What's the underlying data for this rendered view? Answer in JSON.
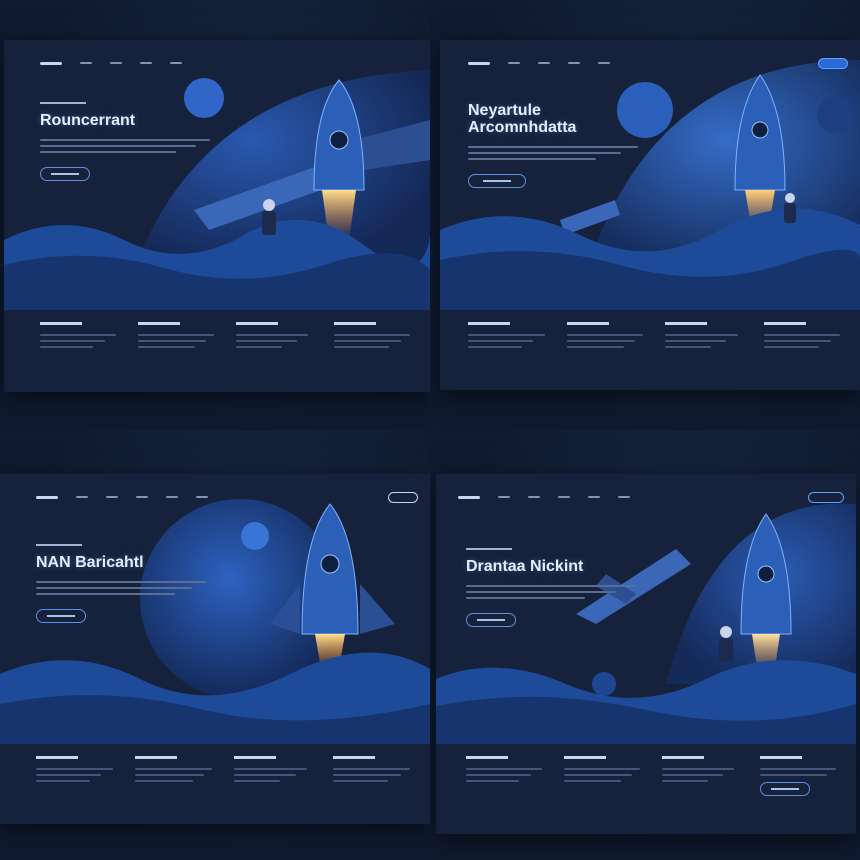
{
  "panels": [
    {
      "id": "q1",
      "headline": "Rouncerrant"
    },
    {
      "id": "q2",
      "headline": "Neyartule Arcomnhdatta"
    },
    {
      "id": "q3",
      "headline": "NAN Baricahtl"
    },
    {
      "id": "q4",
      "headline": "Drantaa Nickint"
    }
  ],
  "colors": {
    "page_bg": "#0e1626",
    "card_bg": "#16223c",
    "accent_blue": "#2a6ad6",
    "flame": "#ffb347",
    "hills": "#1e4a9a"
  },
  "icons": [
    "rocket-icon",
    "astronaut-icon",
    "planet-icon",
    "spaceship-icon"
  ]
}
